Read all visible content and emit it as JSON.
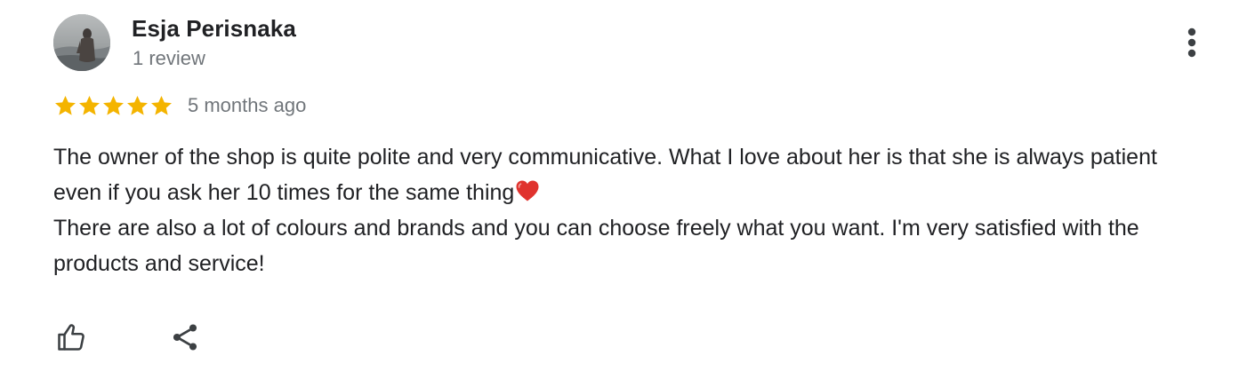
{
  "reviewer": {
    "name": "Esja Perisnaka",
    "review_count": "1 review",
    "avatar_icon": "profile-photo-avatar"
  },
  "menu": {
    "icon": "more-vert-icon"
  },
  "rating": {
    "stars": 5,
    "max": 5,
    "star_color": "#F4B400",
    "time_ago": "5 months ago"
  },
  "review": {
    "paragraph_1": "The owner of the shop is quite polite and very communicative. What I love about her is that she is always patient even if you ask her 10 times for the same thing",
    "paragraph_1_emoji": "red-heart-emoji",
    "paragraph_2": "There are also a lot of colours and brands and you can choose freely what you want. I'm very satisfied with the products and service!"
  },
  "actions": {
    "like_icon": "thumbs-up-icon",
    "share_icon": "share-icon"
  },
  "colors": {
    "primary_text": "#202124",
    "secondary_text": "#70757a",
    "icon_color": "#3c4043",
    "heart": "#e0332e"
  }
}
